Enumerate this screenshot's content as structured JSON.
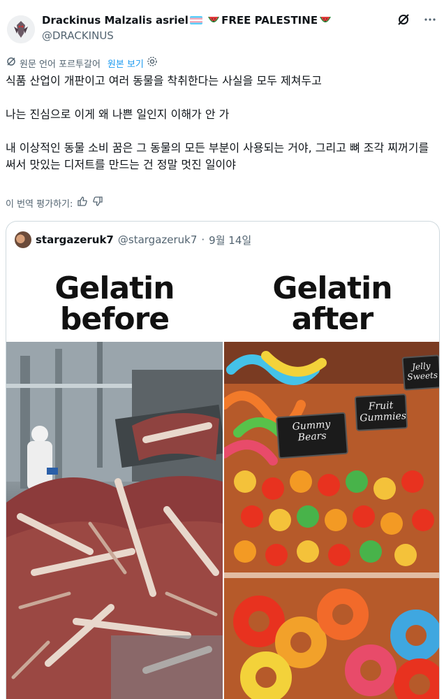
{
  "author": {
    "display_name": "Drackinus Malzalis asriel",
    "display_suffix": "FREE PALESTINE",
    "handle": "@DRACKINUS"
  },
  "icons": {
    "grok": "grok-icon",
    "more": "more-icon",
    "translate": "translate-icon",
    "settings": "gear-icon",
    "thumb_up": "thumb-up-icon",
    "thumb_down": "thumb-down-icon"
  },
  "translation": {
    "label": "원문 언어 포르투갈어",
    "show_original": "원본 보기"
  },
  "tweet": {
    "paragraphs": [
      "식품 산업이 개판이고 여러 동물을 착취한다는 사실을 모두 제쳐두고",
      "나는 진심으로 이게 왜 나쁜 일인지 이해가 안 가",
      "내 이상적인 동물 소비 꿈은 그 동물의 모든 부분이 사용되는 거야, 그리고 뼈 조각 찌꺼기를 써서 맛있는 디저트를 만드는 건 정말 멋진 일이야"
    ],
    "rate_label": "이 번역 평가하기:"
  },
  "quote": {
    "name": "stargazeruk7",
    "handle": "@stargazeruk7",
    "separator": "·",
    "date": "9월 14일",
    "image": {
      "left_title_line1": "Gelatin",
      "left_title_line2": "before",
      "right_title_line1": "Gelatin",
      "right_title_line2": "after",
      "sign_gummy_line1": "Gummy",
      "sign_gummy_line2": "Bears",
      "sign_fruit_line1": "Fruit",
      "sign_fruit_line2": "Gummies",
      "sign_jelly_line1": "Jelly",
      "sign_jelly_line2": "Sweets"
    }
  },
  "colors": {
    "text": "#0f1419",
    "secondary": "#536471",
    "link": "#1d9bf0",
    "border": "#cfd9de"
  }
}
